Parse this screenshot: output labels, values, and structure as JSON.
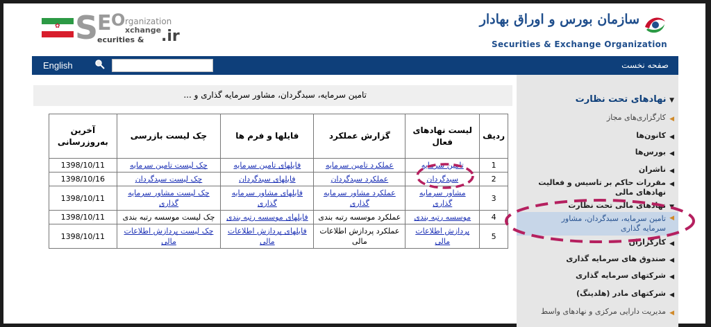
{
  "header": {
    "seo_logo": {
      "big_letters": [
        "S",
        "E",
        "O"
      ],
      "line1": "rganization",
      "line2": "xchange",
      "line3": "ecurities &",
      "suffix": ".ir"
    },
    "org_title_fa": "سازمان بورس و اوراق بهادار",
    "org_title_en": "Securities & Exchange Organization"
  },
  "topbar": {
    "language_link": "English",
    "search_placeholder": "",
    "search_value": "",
    "home_link": "صفحه نخست"
  },
  "sidebar": {
    "heading": "نهادهای تحت نظارت",
    "items": [
      {
        "label": "کارگزاری‌های مجاز",
        "style": "orange"
      },
      {
        "label": "کانون‌ها",
        "style": "bold"
      },
      {
        "label": "بورس‌ها",
        "style": "bold"
      },
      {
        "label": "ناشران",
        "style": "bold"
      },
      {
        "label": "مقررات حاکم بر تاسیس و فعالیت نهادهای مالی",
        "style": "bold"
      },
      {
        "label": "نهادهای مالی تحت نظارت",
        "style": "bold-expanded"
      },
      {
        "label": "تامین سرمایه، سبدگردان، مشاور سرمایه گذاری",
        "style": "active"
      },
      {
        "label": "کارگزاران",
        "style": "bold"
      },
      {
        "label": "صندوق های سرمایه گذاری",
        "style": "bold"
      },
      {
        "label": "شرکتهای سرمایه گذاری",
        "style": "bold"
      },
      {
        "label": "شرکتهای مادر (هلدینگ)",
        "style": "bold"
      },
      {
        "label": "مدیریت دارایی مرکزی و نهادهای واسط",
        "style": "plain"
      }
    ]
  },
  "content": {
    "page_title": "تامین سرمایه، سبدگردان، مشاور سرمایه گذاری و ...",
    "table": {
      "headers": [
        "ردیف",
        "لیست نهادهای فعال",
        "گزارش عملکرد",
        "فایلها و فرم ها",
        "چک لیست بازرسی",
        "آخرین به‌روزرسانی"
      ],
      "rows": [
        {
          "num": "1",
          "list": "تامین سرمایه",
          "report": "عملکرد تامین سرمایه",
          "files": "فایلهای تامین سرمایه",
          "check": "چک لیست تامین سرمایه",
          "date": "1398/10/11"
        },
        {
          "num": "2",
          "list": "سبدگردان",
          "report": "عملکرد سبدگردان",
          "files": "فایلهای سبدگردان",
          "check": "چک لیست سبدگردان",
          "date": "1398/10/16"
        },
        {
          "num": "3",
          "list": "مشاور سرمایه گذاری",
          "report": "عملکرد مشاور سرمایه گذاری",
          "files": "فایلهای مشاور سرمایه گذاری",
          "check": "چک لیست مشاور سرمایه گذاری",
          "date": "1398/10/11"
        },
        {
          "num": "4",
          "list": "موسسه رتبه بندی",
          "report": "عملکرد موسسه رتبه بندی",
          "files": "فایلهای موسسه رتبه بندی",
          "check": "چک لیست موسسه رتبه بندی",
          "date": "1398/10/11"
        },
        {
          "num": "5",
          "list": "پردازش اطلاعات مالی",
          "report": "عملکرد پردازش اطلاعات مالی",
          "files": "فایلهای پردازش اطلاعات مالی",
          "check": "چک لیست پردازش اطلاعات مالی",
          "date": "1398/10/11"
        }
      ]
    }
  },
  "colors": {
    "nav_blue": "#0e3f7a",
    "link_blue": "#1a2fb4",
    "sidebar_bg": "#e6e6e6",
    "active_bg": "#c7d6e8",
    "annotation": "#b5205f"
  }
}
